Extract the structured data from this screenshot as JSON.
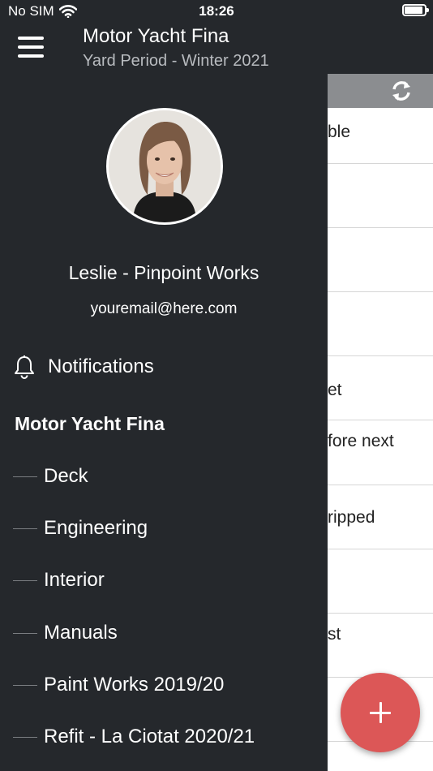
{
  "status_bar": {
    "carrier": "No SIM",
    "time": "18:26",
    "wifi_icon": "wifi-icon",
    "battery_icon": "battery-icon"
  },
  "header": {
    "title": "Motor Yacht Fina",
    "subtitle": "Yard Period - Winter 2021",
    "menu_icon": "hamburger-menu-icon"
  },
  "drawer": {
    "user": {
      "name": "Leslie - Pinpoint Works",
      "email": "youremail@here.com"
    },
    "notifications_label": "Notifications",
    "vessel_heading": "Motor Yacht Fina",
    "items": [
      {
        "label": "Deck"
      },
      {
        "label": "Engineering"
      },
      {
        "label": "Interior"
      },
      {
        "label": "Manuals"
      },
      {
        "label": "Paint Works 2019/20"
      },
      {
        "label": "Refit - La Ciotat 2020/21"
      }
    ]
  },
  "background_list": {
    "sync_icon": "sync-icon",
    "rows": [
      "ble",
      "",
      "",
      "",
      "et",
      "fore next",
      "ripped",
      "",
      "st",
      ""
    ]
  },
  "fab": {
    "icon": "plus-icon"
  },
  "colors": {
    "drawer_bg": "#25282c",
    "fab": "#dc5757",
    "toolbar": "#8b8d90"
  }
}
